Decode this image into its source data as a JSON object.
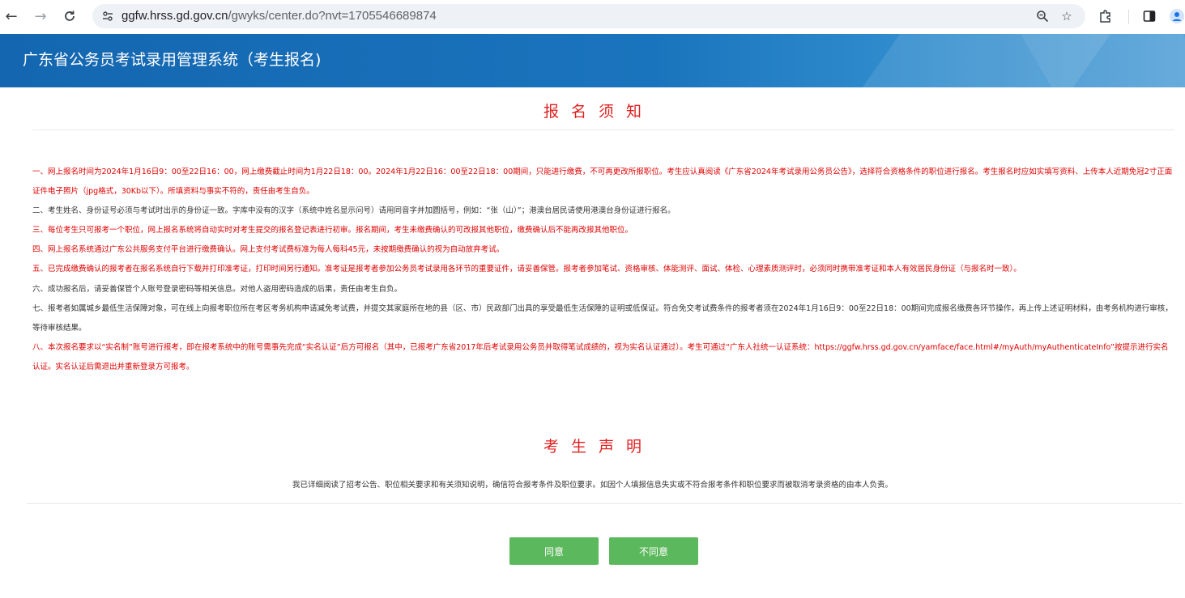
{
  "browser": {
    "url_host": "ggfw.hrss.gd.gov.cn",
    "url_path": "/gwyks/center.do?nvt=1705546689874",
    "icons": [
      "back-icon",
      "forward-icon",
      "reload-icon",
      "site-info-icon",
      "zoom-icon",
      "star-icon",
      "extensions-icon",
      "side-panel-icon",
      "profile-icon"
    ]
  },
  "header": {
    "title": "广东省公务员考试录用管理系统（考生报名)"
  },
  "notice": {
    "title": "报名须知",
    "items": [
      {
        "text": "一、网上报名时间为2024年1月16日9：00至22日16：00，网上缴费截止时间为1月22日18：00。2024年1月22日16：00至22日18：00期间，只能进行缴费，不可再更改所报职位。考生应认真阅读《广东省2024年考试录用公务员公告》，选择符合资格条件的职位进行报名。考生报名时应如实填写资料、上传本人近期免冠2寸正面证件电子照片（jpg格式，30Kb以下）。所填资料与事实不符的，责任由考生自负。",
        "color": "red"
      },
      {
        "text": "二、考生姓名、身份证号必须与考试时出示的身份证一致。字库中没有的汉字（系统中姓名显示问号）请用同音字并加圆括号，例如：“张（山）”；港澳台居民请使用港澳台身份证进行报名。",
        "color": "black"
      },
      {
        "text": "三、每位考生只可报考一个职位，网上报名系统将自动实时对考生提交的报名登记表进行初审。报名期间，考生未缴费确认的可改报其他职位，缴费确认后不能再改报其他职位。",
        "color": "red"
      },
      {
        "text": "四、网上报名系统通过广东公共服务支付平台进行缴费确认。网上支付考试费标准为每人每科45元，未按期缴费确认的视为自动放弃考试。",
        "color": "red"
      },
      {
        "text": "五、已完成缴费确认的报考者在报名系统自行下载并打印准考证，打印时间另行通知。准考证是报考者参加公务员考试录用各环节的重要证件，请妥善保管。报考者参加笔试、资格审核、体能测评、面试、体检、心理素质测评时，必须同时携带准考证和本人有效居民身份证（与报名时一致）。",
        "color": "red"
      },
      {
        "text": "六、成功报名后，请妥善保管个人账号登录密码等相关信息。对他人盗用密码造成的后果，责任由考生自负。",
        "color": "black"
      },
      {
        "text": "七、报考者如属城乡最低生活保障对象，可在线上向报考职位所在考区考务机构申请减免考试费，并提交其家庭所在地的县（区、市）民政部门出具的享受最低生活保障的证明或低保证。符合免交考试费条件的报考者须在2024年1月16日9：00至22日18：00期间完成报名缴费各环节操作，再上传上述证明材料，由考务机构进行审核，等待审核结果。",
        "color": "black"
      },
      {
        "text": "八、本次报名要求以“实名制”账号进行报考，即在报考系统中的账号需事先完成“实名认证”后方可报名（其中，已报考广东省2017年后考试录用公务员并取得笔试成绩的，视为实名认证通过）。考生可通过“广东人社统一认证系统：https://ggfw.hrss.gd.gov.cn/yamface/face.html#/myAuth/myAuthenticateInfo”按提示进行实名认证。实名认证后需退出并重新登录方可报考。",
        "color": "red"
      }
    ]
  },
  "statement": {
    "title": "考生声明",
    "text": "我已详细阅读了招考公告、职位相关要求和有关须知说明，确信符合报考条件及职位要求。如因个人填报信息失实或不符合报考条件和职位要求而被取消考录资格的由本人负责。"
  },
  "actions": {
    "agree_label": "同意",
    "disagree_label": "不同意",
    "button_color": "#5cb85c"
  }
}
